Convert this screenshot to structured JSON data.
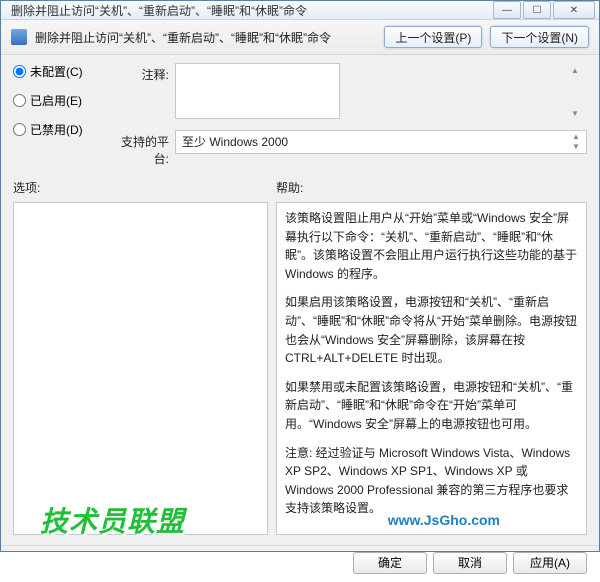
{
  "window": {
    "title": "删除并阻止访问“关机”、“重新启动”、“睡眠”和“休眠”命令"
  },
  "header": {
    "title": "删除并阻止访问“关机”、“重新启动”、“睡眠”和“休眠”命令",
    "prev": "上一个设置(P)",
    "next": "下一个设置(N)"
  },
  "radios": {
    "not_configured": "未配置(C)",
    "enabled": "已启用(E)",
    "disabled": "已禁用(D)"
  },
  "fields": {
    "comment_label": "注释:",
    "comment_value": "",
    "platform_label": "支持的平台:",
    "platform_value": "至少 Windows 2000"
  },
  "sections": {
    "options": "选项:",
    "help": "帮助:"
  },
  "help": {
    "p1": "该策略设置阻止用户从“开始”菜单或“Windows 安全”屏幕执行以下命令：“关机”、“重新启动”、“睡眠”和“休眠”。该策略设置不会阻止用户运行执行这些功能的基于 Windows 的程序。",
    "p2": "如果启用该策略设置，电源按钮和“关机”、“重新启动”、“睡眠”和“休眠”命令将从“开始”菜单删除。电源按钮也会从“Windows 安全”屏幕删除，该屏幕在按 CTRL+ALT+DELETE 时出现。",
    "p3": "如果禁用或未配置该策略设置，电源按钮和“关机”、“重新启动”、“睡眠”和“休眠”命令在“开始”菜单可用。“Windows 安全”屏幕上的电源按钮也可用。",
    "p4": "注意: 经过验证与 Microsoft Windows Vista、Windows XP SP2、Windows XP SP1、Windows XP 或 Windows 2000 Professional 兼容的第三方程序也要求支持该策略设置。"
  },
  "footer": {
    "ok": "确定",
    "cancel": "取消",
    "apply": "应用(A)"
  },
  "watermark": {
    "main": "技术员联盟",
    "sub": "www.JsGho.com"
  }
}
